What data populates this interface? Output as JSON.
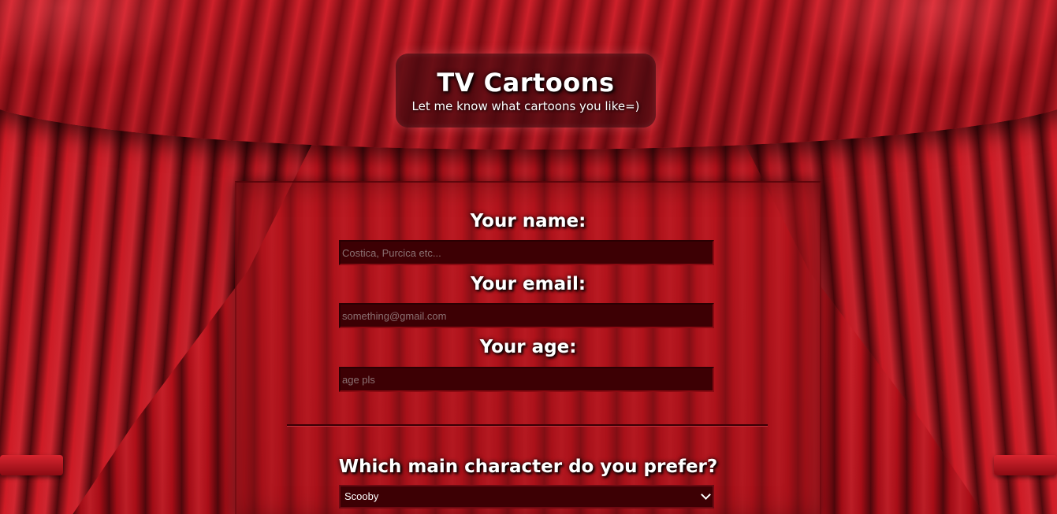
{
  "header": {
    "title": "TV Cartoons",
    "subtitle": "Let me know what cartoons you like=)"
  },
  "form": {
    "name": {
      "label": "Your name:",
      "placeholder": "Costica, Purcica etc..."
    },
    "email": {
      "label": "Your email:",
      "placeholder": "something@gmail.com"
    },
    "age": {
      "label": "Your age:",
      "placeholder": "age pls"
    },
    "character": {
      "label": "Which main character do you prefer?",
      "selected": "Scooby"
    }
  },
  "colors": {
    "curtain": "#c0141e",
    "panel": "#aa141c",
    "input_bg": "#3d0004",
    "text": "#ffffff"
  },
  "icons": {
    "select_arrow": "chevron-down-icon"
  }
}
